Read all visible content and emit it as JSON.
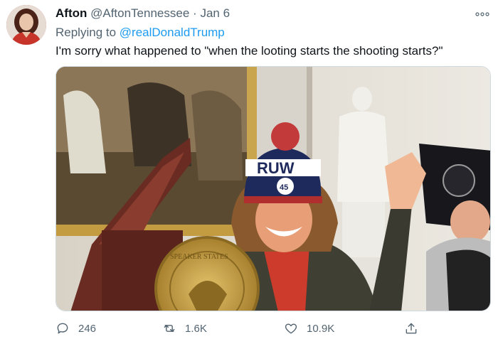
{
  "tweet": {
    "display_name": "Afton",
    "handle": "@AftonTennessee",
    "separator": "·",
    "date": "Jan 6",
    "replying_to_prefix": "Replying to",
    "replying_to_handle": "@realDonaldTrump",
    "text": "I'm sorry what happened to \"when the looting starts the shooting starts?\""
  },
  "actions": {
    "reply_count": "246",
    "retweet_count": "1.6K",
    "like_count": "10.9K"
  },
  "icons": {
    "more": "more-horizontal-icon",
    "reply": "reply-icon",
    "retweet": "retweet-icon",
    "like": "heart-icon",
    "share": "share-icon"
  },
  "media": {
    "hat_text": "RUW",
    "badge_number": "45",
    "seal_text": "SPEAKER STATES"
  },
  "colors": {
    "link": "#1d9bf0",
    "secondary": "#536471",
    "primary_text": "#0f1419"
  }
}
